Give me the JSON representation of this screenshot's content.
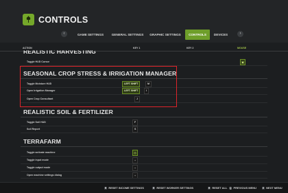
{
  "header": {
    "title": "CONTROLS",
    "app_icon": "wheat-icon",
    "nav_prev": "‹",
    "nav_next": "›",
    "tabs": [
      {
        "label": "GAME SETTINGS",
        "active": false
      },
      {
        "label": "GENERAL SETTINGS",
        "active": false
      },
      {
        "label": "GRAPHIC SETTINGS",
        "active": false
      },
      {
        "label": "CONTROLS",
        "active": true
      },
      {
        "label": "DEVICES",
        "active": false
      }
    ]
  },
  "columns": {
    "action": "ACTION",
    "key1": "KEY 1",
    "key2": "KEY 2",
    "mouse": "MOUSE"
  },
  "sections": [
    {
      "title": "REALISTIC HARVESTING",
      "rows": [
        {
          "label": "Toggle HUD Cursor",
          "key1": "",
          "mouse_icon": "mouse-icon"
        }
      ]
    },
    {
      "title": "SEASONAL CROP STRESS & IRRIGATION MANAGER",
      "rows": [
        {
          "label": "Toggle Moisture HUD",
          "key1": "LEFT SHIFT",
          "key1b": "M"
        },
        {
          "label": "Open Irrigation Manager",
          "key1": "LEFT SHIFT",
          "key1b": "I"
        },
        {
          "label": "Open Crop Consultant",
          "key1": "",
          "key1b": "J"
        }
      ]
    },
    {
      "title": "REALISTIC SOIL & FERTILIZER",
      "rows": [
        {
          "label": "Toggle Soil HUD",
          "key1": "",
          "key1b": "F"
        },
        {
          "label": "Soil Report",
          "key1": "",
          "key1b": "S"
        }
      ]
    },
    {
      "title": "TERRAFARM",
      "rows": [
        {
          "label": "Toggle activate machine",
          "key1": "",
          "key1b": "◎"
        },
        {
          "label": "Toggle input mode",
          "key1": "",
          "key1b": "+"
        },
        {
          "label": "Toggle output mode",
          "key1": "",
          "key1b": "+"
        },
        {
          "label": "Open machine settings dialog",
          "key1": "",
          "key1b": "+"
        }
      ]
    }
  ],
  "footer": [
    {
      "key": "R",
      "label": "RESET INCOME SETTINGS"
    },
    {
      "key": "R",
      "label": "RESET WORKER SETTINGS"
    },
    {
      "key": "R",
      "label": "RESET ALL"
    },
    {
      "key": "Q",
      "label": "PREVIOUS MENU"
    },
    {
      "key": "E",
      "label": "NEXT MENU"
    }
  ],
  "colors": {
    "accent": "#6e9e2a",
    "highlight": "#e0242a",
    "background": "#1c1e20"
  }
}
